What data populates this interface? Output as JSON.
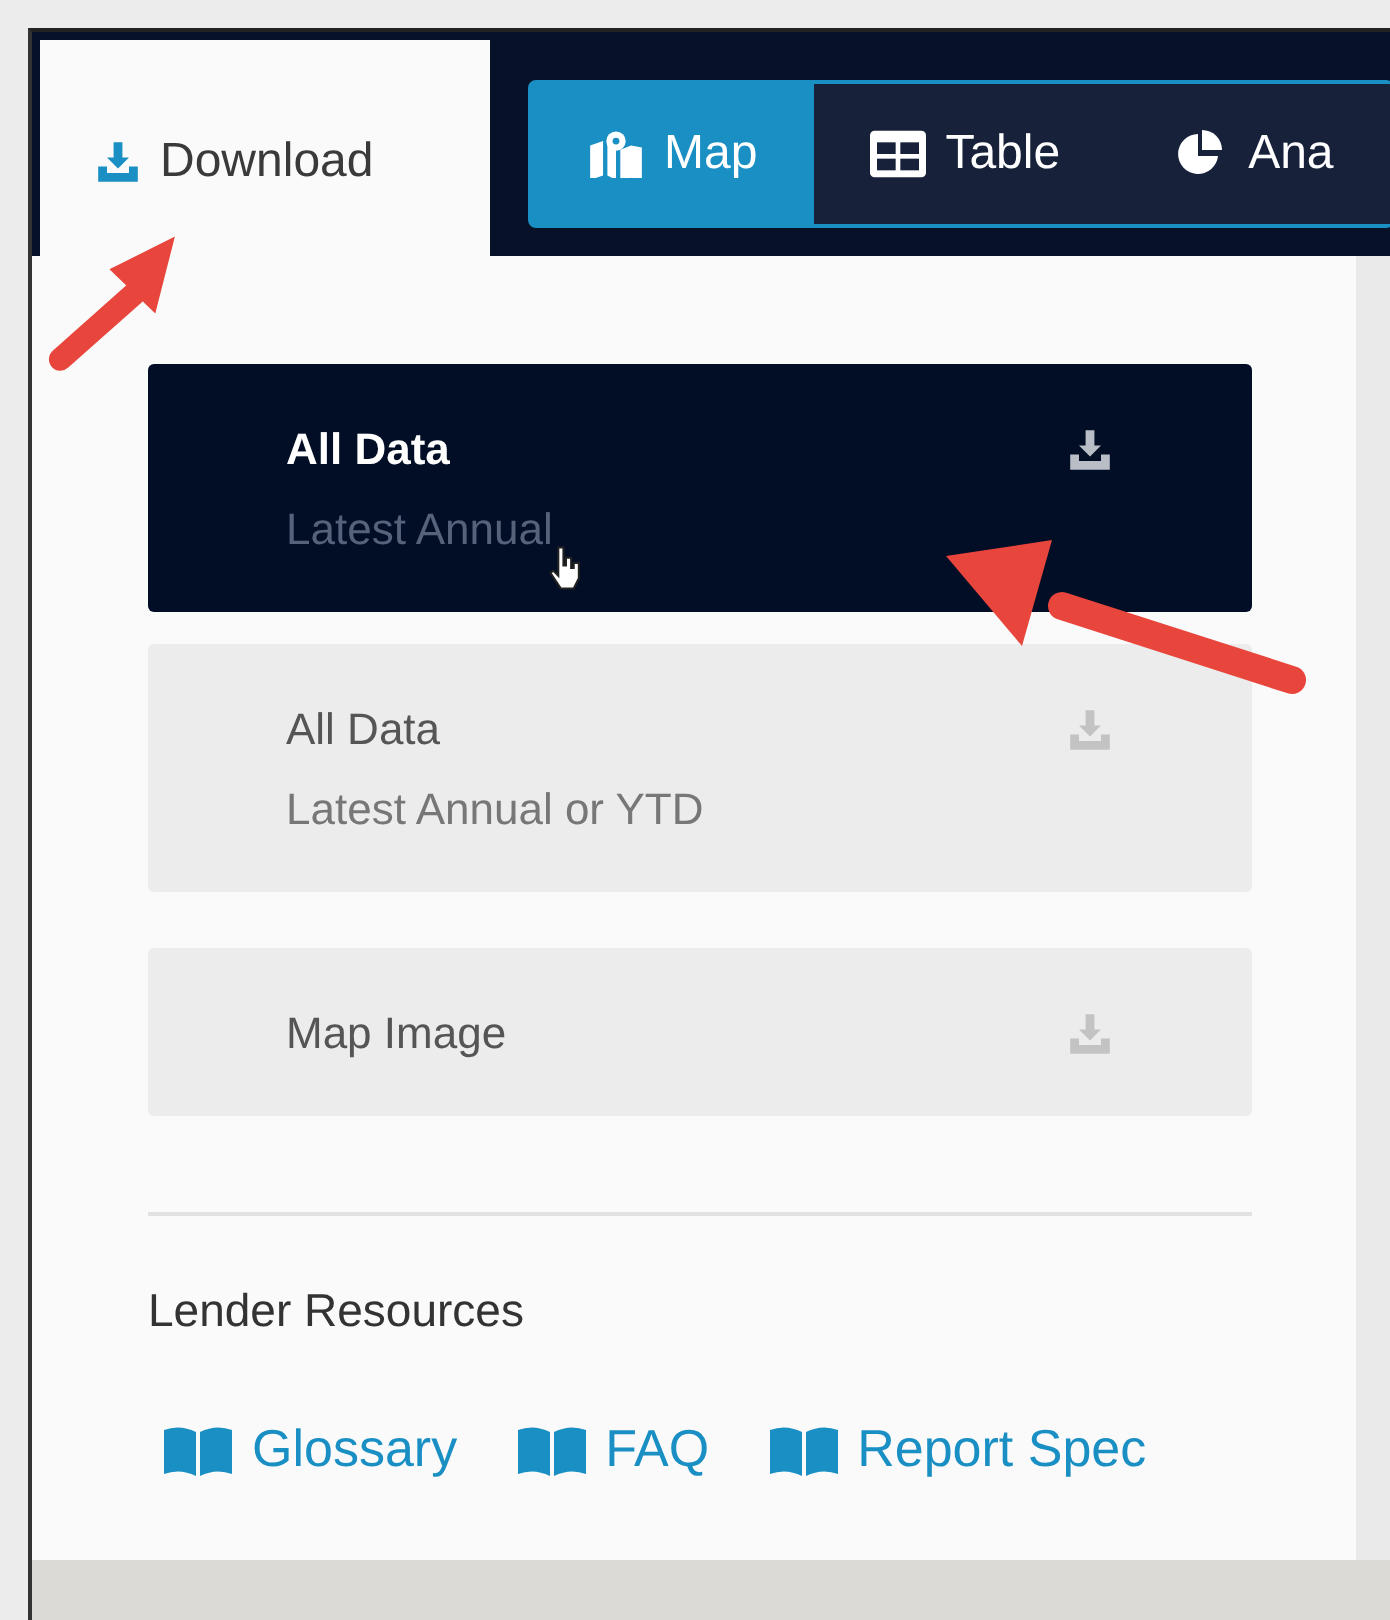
{
  "download_tab": {
    "label": "Download",
    "selected": true
  },
  "view_tabs": [
    {
      "label": "Map",
      "kind": "map",
      "selected": true
    },
    {
      "label": "Table",
      "kind": "table",
      "selected": false
    },
    {
      "label": "Ana",
      "kind": "chart",
      "selected": false
    }
  ],
  "downloads": [
    {
      "title": "All Data",
      "subtitle": "Latest Annual",
      "selected": true
    },
    {
      "title": "All Data",
      "subtitle": "Latest Annual or YTD",
      "selected": false
    },
    {
      "title": "Map Image",
      "selected": false
    }
  ],
  "resources": {
    "heading": "Lender Resources",
    "links": [
      "Glossary",
      "FAQ",
      "Report Spec"
    ]
  }
}
